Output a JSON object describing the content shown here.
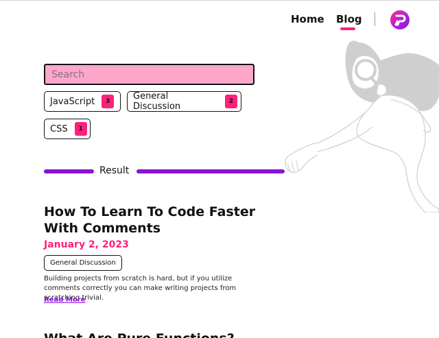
{
  "nav": {
    "home_label": "Home",
    "blog_label": "Blog",
    "active": "Blog",
    "accent_color": "#ff1f7a",
    "logo_icon": "brand-logo-icon"
  },
  "search": {
    "placeholder": "Search",
    "value": ""
  },
  "tags": [
    {
      "label": "JavaScript",
      "count": "3"
    },
    {
      "label": "General Discussion",
      "count": "2"
    },
    {
      "label": "CSS",
      "count": "1"
    }
  ],
  "result": {
    "label": "Result"
  },
  "posts": [
    {
      "title": "How To Learn To Code Faster With Comments",
      "date": "January 2, 2023",
      "tag": "General Discussion",
      "excerpt": "Building projects from scratch is hard, but if you utilize comments correctly you can make writing projects from scratching trivial.",
      "read_more": "Read More"
    },
    {
      "title": "What Are Pure Functions?"
    }
  ],
  "colors": {
    "search_bg": "#ffa6cb",
    "badge": "#ff1f7a",
    "divider_bar": "#8a12d6",
    "date": "#ff1f7a",
    "link": "#8a12d6"
  },
  "illustration": {
    "icon": "woman-with-magnifying-glass-illustration"
  }
}
